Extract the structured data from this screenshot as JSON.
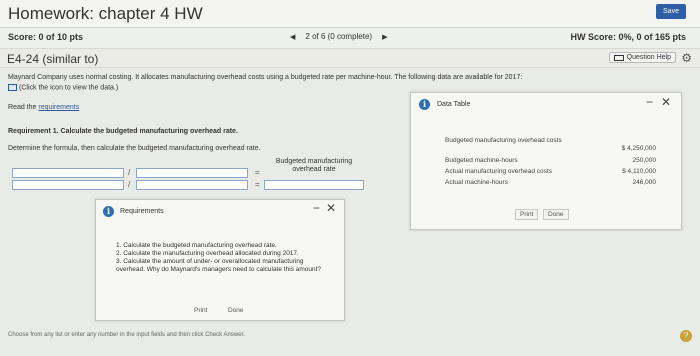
{
  "header": {
    "title": "Homework: chapter 4 HW",
    "save_label": "Save"
  },
  "scorebar": {
    "score": "Score: 0 of 10 pts",
    "pager": "2 of 6 (0 complete)",
    "hw_score": "HW Score: 0%, 0 of 165 pts"
  },
  "question": {
    "title": "E4-24 (similar to)",
    "help_label": "Question Help"
  },
  "body": {
    "intro": "Maynard Company uses normal costing. It allocates manufacturing overhead costs using a budgeted rate per machine-hour. The following data are available for 2017:",
    "click_note": "(Click the icon to view the data.)",
    "read_prefix": "Read the ",
    "read_link": "requirements",
    "requirement_heading": "Requirement 1. Calculate the budgeted manufacturing overhead rate.",
    "instruction": "Determine the formula, then calculate the budgeted manufacturing overhead rate.",
    "formula_label": "Budgeted manufacturing overhead rate",
    "div_op": "/",
    "eq_op": "="
  },
  "data_table": {
    "title": "Data Table",
    "rows": [
      {
        "label": "Budgeted manufacturing overhead costs",
        "value": "$ 4,250,000"
      },
      {
        "label": "Budgeted machine-hours",
        "value": "250,000"
      },
      {
        "label": "Actual manufacturing overhead costs",
        "value": "$ 4,110,000"
      },
      {
        "label": "Actual machine-hours",
        "value": "246,000"
      }
    ],
    "print_label": "Print",
    "done_label": "Done"
  },
  "requirements": {
    "title": "Requirements",
    "items": [
      "1. Calculate the budgeted manufacturing overhead rate.",
      "2. Calculate the manufacturing overhead allocated during 2017.",
      "3. Calculate the amount of under- or overallocated manufacturing overhead. Why do Maynard's managers need to calculate this amount?"
    ],
    "print_label": "Print",
    "done_label": "Done"
  },
  "footer": {
    "instruction": "Choose from any list or enter any number in the input fields and then click Check Answer."
  },
  "icons": {
    "info": "info-icon",
    "gear": "gear-icon",
    "help": "help-icon",
    "minimize": "minimize-icon",
    "close": "close-icon"
  }
}
